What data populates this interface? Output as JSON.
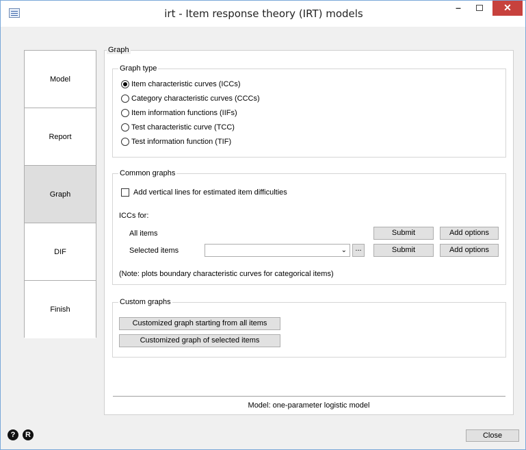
{
  "window": {
    "title": "irt - Item response theory (IRT) models"
  },
  "sidebar": {
    "tabs": [
      {
        "label": "Model"
      },
      {
        "label": "Report"
      },
      {
        "label": "Graph"
      },
      {
        "label": "DIF"
      },
      {
        "label": "Finish"
      }
    ],
    "active": "Graph"
  },
  "panel": {
    "title": "Graph",
    "graph_type": {
      "legend": "Graph type",
      "options": [
        {
          "label": "Item characteristic curves (ICCs)",
          "checked": true
        },
        {
          "label": "Category characteristic curves (CCCs)",
          "checked": false
        },
        {
          "label": "Item information functions (IIFs)",
          "checked": false
        },
        {
          "label": "Test characteristic curve (TCC)",
          "checked": false
        },
        {
          "label": "Test information function (TIF)",
          "checked": false
        }
      ]
    },
    "common_graphs": {
      "legend": "Common graphs",
      "checkbox_label": "Add vertical lines for estimated item difficulties",
      "iccs_for": "ICCs for:",
      "all_items": "All items",
      "selected_items": "Selected items",
      "selected_value": "",
      "ellipsis": "...",
      "submit": "Submit",
      "add_options": "Add options",
      "note": "(Note: plots boundary characteristic curves for categorical items)"
    },
    "custom_graphs": {
      "legend": "Custom graphs",
      "btn_all": "Customized graph starting from all items",
      "btn_selected": "Customized graph of selected items"
    },
    "status": "Model: one-parameter logistic model"
  },
  "footer": {
    "help_icon": "?",
    "reset_icon": "R",
    "close": "Close"
  },
  "colors": {
    "close_button": "#c7413d",
    "active_tab": "#dedede"
  }
}
